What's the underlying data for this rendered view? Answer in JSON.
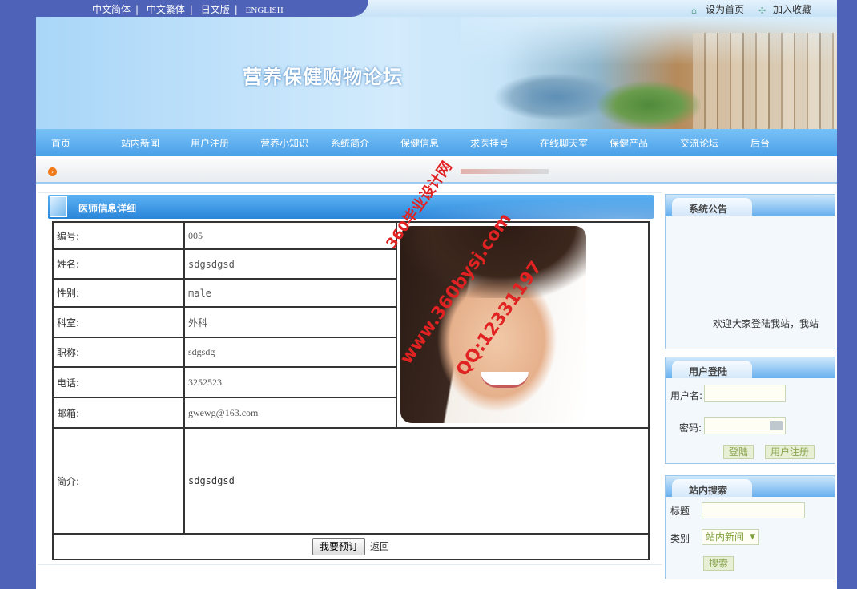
{
  "languages": [
    "中文简体",
    "中文繁体",
    "日文版",
    "ENGLISH"
  ],
  "toplinks": {
    "home_label": "设为首页",
    "favorite_label": "加入收藏"
  },
  "site_title": "营养保健购物论坛",
  "nav": [
    "首页",
    "站内新闻",
    "用户注册",
    "营养小知识",
    "系统简介",
    "保健信息",
    "求医挂号",
    "在线聊天室",
    "保健产品",
    "交流论坛",
    "后台"
  ],
  "detail": {
    "title": "医师信息详细",
    "fields": [
      {
        "label": "编号:",
        "value": "005"
      },
      {
        "label": "姓名:",
        "value": "sdgsdgsd"
      },
      {
        "label": "性别:",
        "value": "male"
      },
      {
        "label": "科室:",
        "value": "外科"
      },
      {
        "label": "职称:",
        "value": "sdgsdg"
      },
      {
        "label": "电话:",
        "value": "3252523"
      },
      {
        "label": "邮箱:",
        "value": "gwewg@163.com"
      }
    ],
    "intro_label": "简介:",
    "intro_value": "sdgsdgsd",
    "order_button": "我要预订",
    "back_label": "返回"
  },
  "watermark": {
    "line1": "360毕业设计网",
    "line2": "www.360bysj.com",
    "line3": "QQ:12331197"
  },
  "sidebar": {
    "announcement": {
      "title": "系统公告",
      "text": "欢迎大家登陆我站，我站"
    },
    "login": {
      "title": "用户登陆",
      "username_label": "用户名:",
      "password_label": "密码:",
      "login_button": "登陆",
      "register_button": "用户注册"
    },
    "search": {
      "title": "站内搜索",
      "title_label": "标题",
      "category_label": "类别",
      "category_value": "站内新闻",
      "search_button": "搜索"
    }
  }
}
